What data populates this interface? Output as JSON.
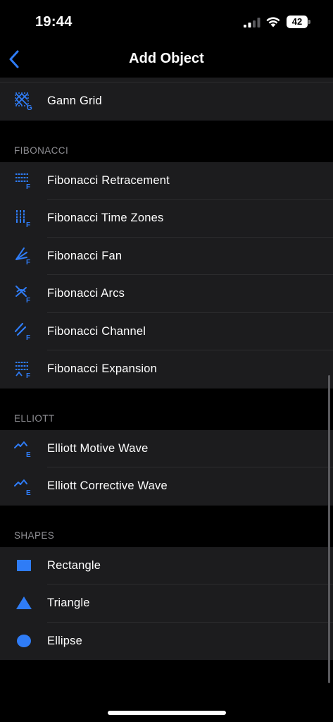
{
  "status": {
    "time": "19:44",
    "battery": "42"
  },
  "nav": {
    "title": "Add Object"
  },
  "top_group": [
    {
      "label": "Gann Grid",
      "icon": "gann-grid-icon"
    }
  ],
  "sections": [
    {
      "header": "FIBONACCI",
      "items": [
        {
          "label": "Fibonacci Retracement",
          "icon": "fibonacci-retracement-icon"
        },
        {
          "label": "Fibonacci Time Zones",
          "icon": "fibonacci-time-zones-icon"
        },
        {
          "label": "Fibonacci Fan",
          "icon": "fibonacci-fan-icon"
        },
        {
          "label": "Fibonacci Arcs",
          "icon": "fibonacci-arcs-icon"
        },
        {
          "label": "Fibonacci Channel",
          "icon": "fibonacci-channel-icon"
        },
        {
          "label": "Fibonacci Expansion",
          "icon": "fibonacci-expansion-icon"
        }
      ]
    },
    {
      "header": "ELLIOTT",
      "items": [
        {
          "label": "Elliott Motive Wave",
          "icon": "elliott-motive-wave-icon"
        },
        {
          "label": "Elliott Corrective Wave",
          "icon": "elliott-corrective-wave-icon"
        }
      ]
    },
    {
      "header": "SHAPES",
      "items": [
        {
          "label": "Rectangle",
          "icon": "rectangle-icon"
        },
        {
          "label": "Triangle",
          "icon": "triangle-icon"
        },
        {
          "label": "Ellipse",
          "icon": "ellipse-icon"
        }
      ]
    }
  ],
  "colors": {
    "accent": "#2f7cf6",
    "background": "#000000",
    "cell": "#1c1c1e",
    "separator": "#2c2c2e",
    "secondary_text": "#8e8e93"
  }
}
